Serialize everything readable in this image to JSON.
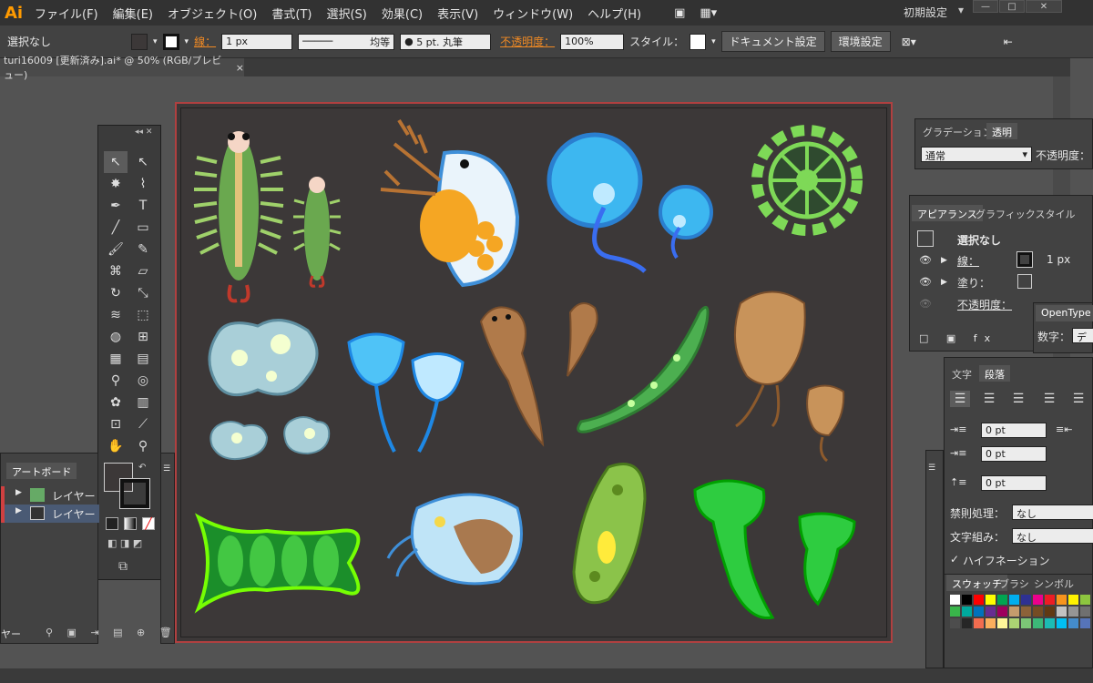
{
  "app": {
    "logo": "Ai",
    "workspace": "初期設定"
  },
  "menu": [
    "ファイル(F)",
    "編集(E)",
    "オブジェクト(O)",
    "書式(T)",
    "選択(S)",
    "効果(C)",
    "表示(V)",
    "ウィンドウ(W)",
    "ヘルプ(H)"
  ],
  "control": {
    "selection": "選択なし",
    "stroke_label": "線：",
    "stroke_value": "1 px",
    "profile": "均等",
    "brush": "5 pt. 丸筆",
    "opacity_label": "不透明度：",
    "opacity_value": "100%",
    "style_label": "スタイル：",
    "doc_settings": "ドキュメント設定",
    "prefs": "環境設定"
  },
  "document": {
    "tab_title": "turi16009 [更新済み].ai* @ 50% (RGB/プレビュー)",
    "close": "×"
  },
  "layers_panel": {
    "tab": "アートボード",
    "layers": [
      "レイヤー",
      "レイヤー"
    ],
    "footer": "ヤー"
  },
  "transparency_panel": {
    "tabs": [
      "グラデーション",
      "透明"
    ],
    "blend_mode": "通常",
    "opacity_label": "不透明度："
  },
  "appearance_panel": {
    "tabs": [
      "アピアランス",
      "グラフィックスタイル"
    ],
    "selection": "選択なし",
    "stroke_label": "線：",
    "stroke_value": "1 px",
    "fill_label": "塗り：",
    "opacity_label": "不透明度："
  },
  "opentype_panel": {
    "tab": "OpenType",
    "label": "数字：",
    "value": "デ"
  },
  "paragraph_panel": {
    "tabs": [
      "文字",
      "段落"
    ],
    "indent1": "0 pt",
    "indent2": "0 pt",
    "indent3": "0 pt",
    "kinsoku_label": "禁則処理：",
    "kinsoku_value": "なし",
    "mojikumi_label": "文字組み：",
    "mojikumi_value": "なし",
    "hyphenation": "ハイフネーション"
  },
  "swatch_panel": {
    "tabs": [
      "スウォッチ",
      "ブラシ",
      "シンボル"
    ],
    "colors": [
      "#ffffff",
      "#000000",
      "#ff0000",
      "#ffff00",
      "#00a651",
      "#00aeef",
      "#2e3192",
      "#ec008c",
      "#ed1c24",
      "#f7941d",
      "#fff200",
      "#8dc63f",
      "#39b54a",
      "#00a99d",
      "#0072bc",
      "#662d91",
      "#9e005d",
      "#c69c6d",
      "#8c6239",
      "#754c24",
      "#603913",
      "#c2c2c2",
      "#959595",
      "#707070",
      "#4d4d4d",
      "#262626",
      "#f26c4f",
      "#fbaf5d",
      "#fff799",
      "#acd373",
      "#7cc576",
      "#3cb878",
      "#1cbbb4",
      "#00bff3",
      "#448ccb",
      "#5674b9"
    ]
  },
  "illustrations": [
    "shrimp",
    "shrimp-small",
    "water-flea",
    "jellyfish",
    "jellyfish-small",
    "radiolaria",
    "amoeba",
    "amoeba-small-1",
    "amoeba-small-2",
    "vorticella",
    "planaria",
    "planaria-small",
    "closterium",
    "tadpole-shrimp",
    "tadpole-shrimp-small",
    "diatom-chain",
    "daphnia",
    "paramecium",
    "stentor"
  ]
}
